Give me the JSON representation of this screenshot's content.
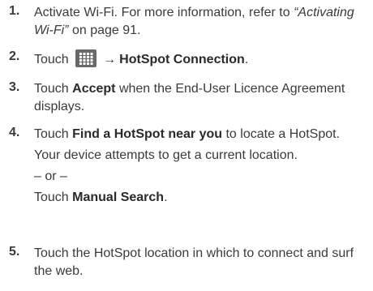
{
  "steps": [
    {
      "number": "1.",
      "lines": [
        "Activate Wi-Fi. For more information, refer to ",
        "Wi-Fi” on page 91."
      ],
      "italic_ref_a": "“Activating",
      "italic_ref_b": "Wi-Fi”",
      "suffix": " on page 91."
    },
    {
      "number": "2.",
      "pre": "Touch",
      "icon": "grid-menu-icon",
      "arrow": "→",
      "target": "HotSpot Connection",
      "post": "."
    },
    {
      "number": "3.",
      "pre": "Touch ",
      "bold": "Accept",
      "post": " when the End-User Licence Agreement",
      "line2": "displays."
    },
    {
      "number": "4.",
      "pre": "Touch ",
      "bold": "Find a HotSpot near you",
      "post": " to locate a HotSpot.",
      "line2": "Your device attempts to get a current location.",
      "or": "– or –",
      "alt_pre": "Touch ",
      "alt_bold": "Manual Search",
      "alt_post": "."
    },
    {
      "number": "5.",
      "line1": "Touch the HotSpot location in which to connect and surf",
      "line2": "the web."
    }
  ]
}
